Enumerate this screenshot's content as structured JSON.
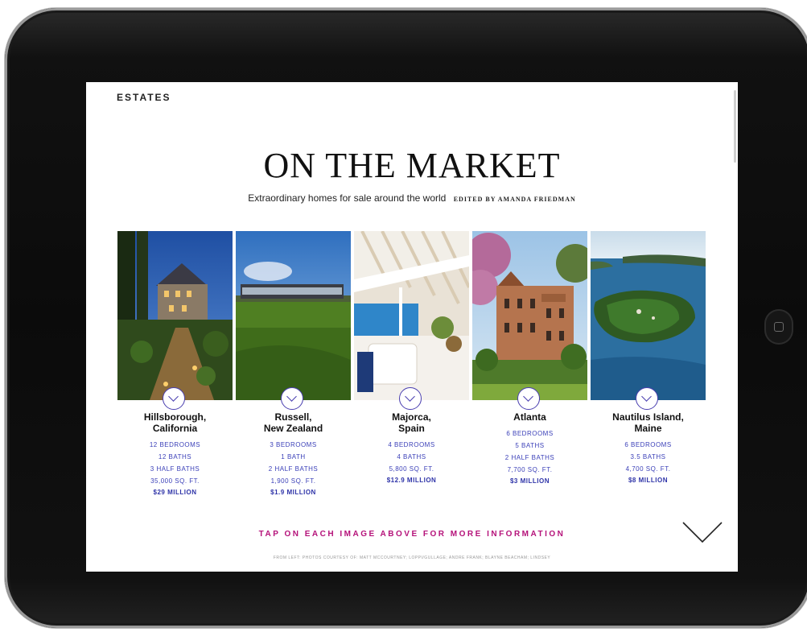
{
  "page": {
    "section": "ESTATES",
    "headline": "ON THE MARKET",
    "subtitle": "Extraordinary homes for sale around the world",
    "editor": "EDITED BY AMANDA FRIEDMAN",
    "tap_prompt": "TAP ON EACH IMAGE ABOVE FOR MORE INFORMATION",
    "credits": "FROM LEFT: PHOTOS COURTESY OF: MATT MCCOURTNEY; LOPPI/GULLAGE; ANDRE FRANK; BLAYNE BEACHAM; LINDSEY"
  },
  "properties": [
    {
      "location_line1": "Hillsborough,",
      "location_line2": "California",
      "specs": [
        "12 BEDROOMS",
        "12 BATHS",
        "3 HALF BATHS",
        "35,000 SQ. FT."
      ],
      "price": "$29 MILLION",
      "photo_icon": "house-photo"
    },
    {
      "location_line1": "Russell,",
      "location_line2": "New Zealand",
      "specs": [
        "3 BEDROOMS",
        "1 BATH",
        "2 HALF BATHS",
        "1,900 SQ. FT."
      ],
      "price": "$1.9 MILLION",
      "photo_icon": "house-photo"
    },
    {
      "location_line1": "Majorca,",
      "location_line2": "Spain",
      "specs": [
        "4 BEDROOMS",
        "4 BATHS",
        "5,800 SQ. FT."
      ],
      "price": "$12.9 MILLION",
      "photo_icon": "house-photo"
    },
    {
      "location_line1": "Atlanta",
      "location_line2": "",
      "specs": [
        "6 BEDROOMS",
        "5 BATHS",
        "2 HALF BATHS",
        "7,700 SQ. FT."
      ],
      "price": "$3 MILLION",
      "photo_icon": "house-photo"
    },
    {
      "location_line1": "Nautilus Island,",
      "location_line2": "Maine",
      "specs": [
        "6 BEDROOMS",
        "3.5 BATHS",
        "4,700 SQ. FT."
      ],
      "price": "$8 MILLION",
      "photo_icon": "island-photo"
    }
  ],
  "colors": {
    "spec_text": "#3a3fb8",
    "tap_prompt": "#b5127a",
    "chevron": "#4a3fb0"
  }
}
